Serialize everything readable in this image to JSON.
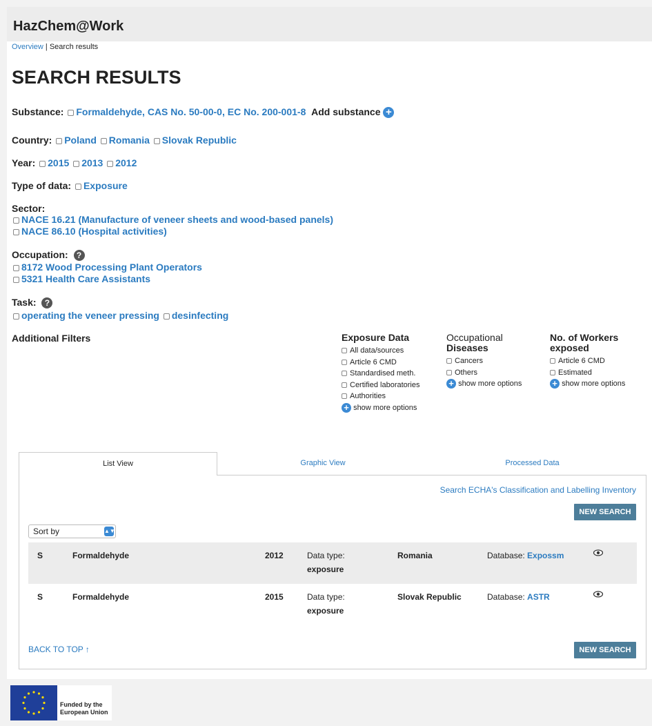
{
  "app": {
    "title": "HazChem@Work"
  },
  "breadcrumb": {
    "overview": "Overview",
    "separator": " | ",
    "current": "Search results"
  },
  "page_title": "SEARCH RESULTS",
  "filters": {
    "substance": {
      "label": "Substance:",
      "values": [
        "Formaldehyde, CAS No. 50-00-0, EC No. 200-001-8"
      ],
      "add_label": "Add substance"
    },
    "country": {
      "label": "Country:",
      "values": [
        "Poland",
        "Romania",
        "Slovak Republic"
      ]
    },
    "year": {
      "label": "Year:",
      "values": [
        "2015",
        "2013",
        "2012"
      ]
    },
    "type_of_data": {
      "label": "Type of data:",
      "values": [
        "Exposure"
      ]
    },
    "sector": {
      "label": "Sector:",
      "values": [
        "NACE 16.21 (Manufacture of veneer sheets and wood-based panels)",
        "NACE 86.10 (Hospital activities)"
      ]
    },
    "occupation": {
      "label": "Occupation:",
      "values": [
        "8172 Wood Processing Plant Operators",
        "5321 Health Care Assistants"
      ]
    },
    "task": {
      "label": "Task:",
      "values": [
        "operating the veneer pressing",
        "desinfecting"
      ]
    }
  },
  "additional_filters": {
    "label": "Additional Filters",
    "exposure_data": {
      "head": "Exposure Data",
      "options": [
        "All data/sources",
        "Article 6 CMD",
        "Standardised meth.",
        "Certified laboratories",
        "Authorities"
      ],
      "more": "show more options"
    },
    "occupational_diseases": {
      "head_line1": "Occupational",
      "head_line2": "Diseases",
      "options": [
        "Cancers",
        "Others"
      ],
      "more": "show more options"
    },
    "workers_exposed": {
      "head_line1": "No. of Workers",
      "head_line2": "exposed",
      "options": [
        "Article 6 CMD",
        "Estimated"
      ],
      "more": "show more options"
    }
  },
  "tabs": [
    "List View",
    "Graphic View",
    "Processed Data"
  ],
  "results": {
    "echa_link": "Search ECHA's Classification and Labelling Inventory",
    "new_search": "NEW SEARCH",
    "sort_label": "Sort by",
    "rows": [
      {
        "flag": "S",
        "substance": "Formaldehyde",
        "year": "2012",
        "type_label": "Data type:",
        "type_value": "exposure",
        "country": "Romania",
        "db_label": "Database:",
        "db_value": "Expossm"
      },
      {
        "flag": "S",
        "substance": "Formaldehyde",
        "year": "2015",
        "type_label": "Data type:",
        "type_value": "exposure",
        "country": "Slovak Republic",
        "db_label": "Database:",
        "db_value": "ASTR"
      }
    ],
    "back_to_top": "BACK TO TOP ↑"
  },
  "footer": {
    "eu_line1": "Funded by the",
    "eu_line2": "European Union"
  },
  "colors": {
    "link": "#2b7bc0",
    "button": "#4d7e9a",
    "header_bg": "#ececec",
    "eu_blue": "#1f3f99",
    "eu_gold": "#ffdd00"
  }
}
